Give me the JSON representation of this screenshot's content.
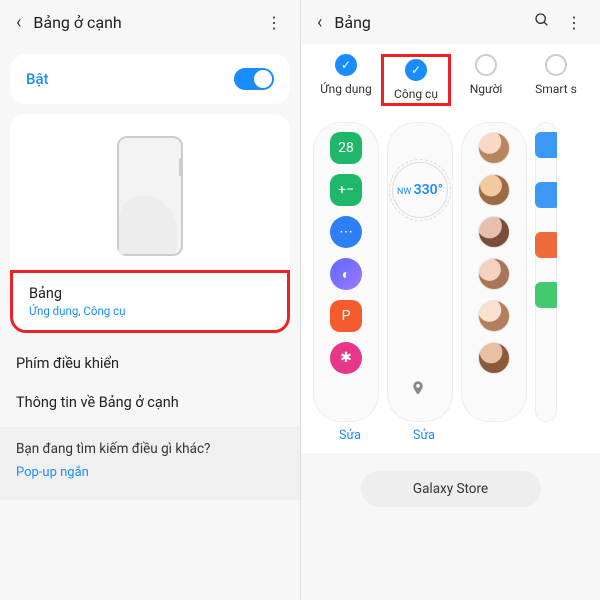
{
  "left": {
    "header_title": "Bảng ở cạnh",
    "toggle_label": "Bật",
    "setting_title": "Bảng",
    "setting_sub": "Ứng dụng, Công cụ",
    "item_controls": "Phím điều khiển",
    "item_about": "Thông tin về Bảng ở cạnh",
    "footer_q": "Bạn đang tìm kiếm điều gì khác?",
    "footer_link": "Pop-up ngắn"
  },
  "right": {
    "header_title": "Bảng",
    "tabs": [
      {
        "label": "Ứng dụng",
        "selected": true
      },
      {
        "label": "Công cụ",
        "selected": true,
        "highlighted": true
      },
      {
        "label": "Người",
        "selected": false
      },
      {
        "label": "Smart s",
        "selected": false
      }
    ],
    "compass_dir": "NW",
    "compass_deg": "330°",
    "edit_label": "Sửa",
    "store_label": "Galaxy Store",
    "icons": {
      "cal": "28",
      "calc": "+−",
      "msg": "⋯",
      "ai": "◐",
      "ppt": "P",
      "pink": "✱"
    }
  }
}
